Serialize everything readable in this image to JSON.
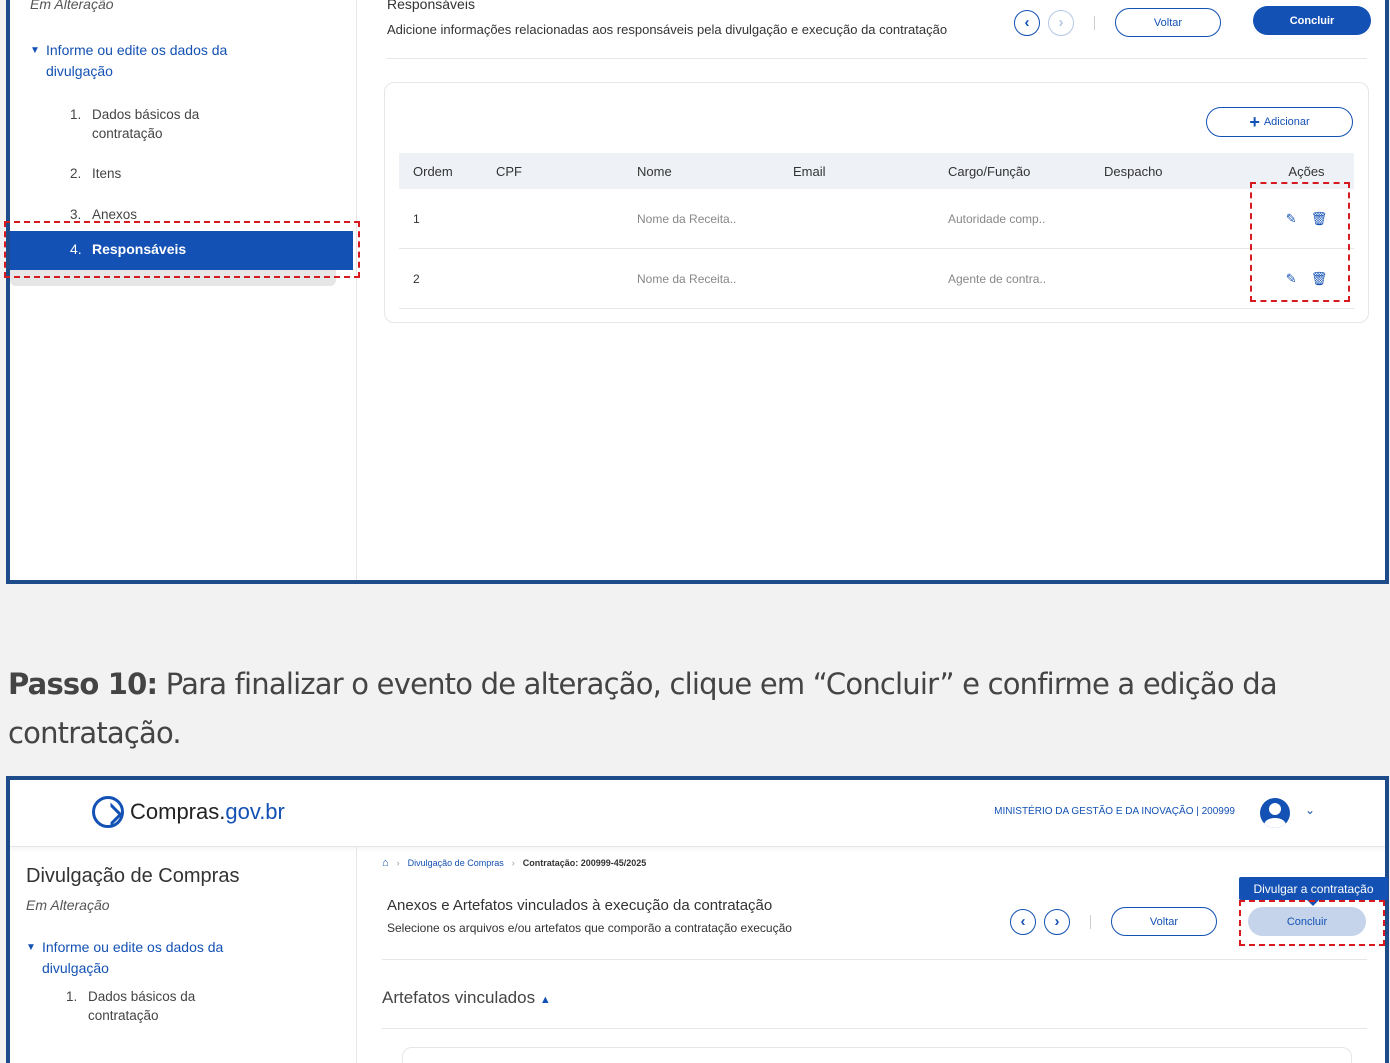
{
  "top_screenshot": {
    "sidebar": {
      "status": "Em Alteração",
      "group_label": "Informe ou edite os dados da divulgação",
      "items": [
        {
          "num": "1.",
          "label": "Dados básicos da contratação"
        },
        {
          "num": "2.",
          "label": "Itens"
        },
        {
          "num": "3.",
          "label": "Anexos"
        },
        {
          "num": "4.",
          "label": "Responsáveis"
        }
      ]
    },
    "header": {
      "title": "Responsáveis",
      "subtitle": "Adicione informações relacionadas aos responsáveis pela divulgação e execução da contratação",
      "back_label": "Voltar",
      "conclude_label": "Concluir"
    },
    "add_button_label": "Adicionar",
    "table": {
      "columns": [
        "Ordem",
        "CPF",
        "Nome",
        "Email",
        "Cargo/Função",
        "Despacho",
        "Ações"
      ],
      "rows": [
        {
          "ordem": "1",
          "cpf": "",
          "nome": "Nome da Receita..",
          "email": "",
          "cargo": "Autoridade comp..",
          "despacho": ""
        },
        {
          "ordem": "2",
          "cpf": "",
          "nome": "Nome da Receita..",
          "email": "",
          "cargo": "Agente de contra..",
          "despacho": ""
        }
      ]
    }
  },
  "instruction": {
    "step_label": "Passo 10:",
    "text": "Para finalizar o evento de alteração, clique em “Concluir” e confirme a edição da contratação."
  },
  "bottom_screenshot": {
    "brand": {
      "name": "Compras.",
      "suffix": "gov.br"
    },
    "org": "MINISTÉRIO DA GESTÃO E DA INOVAÇÃO | 200999",
    "breadcrumb": [
      "Divulgação de Compras",
      "Contratação: 200999-45/2025"
    ],
    "sidebar": {
      "heading": "Divulgação de Compras",
      "status": "Em Alteração",
      "group_label": "Informe ou edite os dados da divulgação",
      "items": [
        {
          "num": "1.",
          "label": "Dados básicos da contratação"
        }
      ]
    },
    "header": {
      "title": "Anexos e Artefatos vinculados à execução da contratação",
      "subtitle": "Selecione os arquivos e/ou artefatos que comporão a contratação execução",
      "back_label": "Voltar",
      "conclude_label": "Concluir",
      "tooltip": "Divulgar a contratação"
    },
    "section_label": "Artefatos vinculados"
  },
  "colors": {
    "primary": "#1351b4",
    "frame": "#1e4b8a",
    "highlight": "#d71920"
  }
}
